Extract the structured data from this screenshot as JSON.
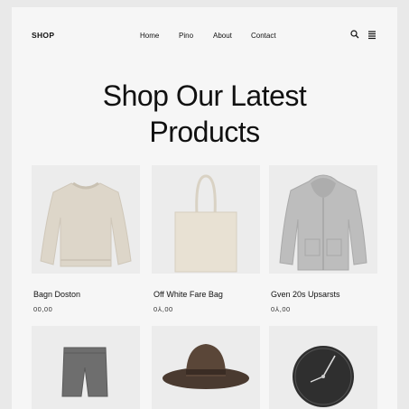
{
  "nav": {
    "logo": "SHOP",
    "links": [
      "Home",
      "Pino",
      "About",
      "Contact"
    ],
    "icons": [
      "search-icon",
      "menu-icon"
    ]
  },
  "hero": {
    "line1": "Shop Our Latest",
    "line2": "Products"
  },
  "products": [
    {
      "name": "Bagn Doston",
      "price": "00,00",
      "image": "sweater"
    },
    {
      "name": "Off White Fare Bag",
      "price": "0⅄,00",
      "image": "tote-bag"
    },
    {
      "name": "Gven 20s Upsarsts",
      "price": "0⅄,00",
      "image": "hoodie"
    },
    {
      "image": "shorts"
    },
    {
      "image": "hat"
    },
    {
      "image": "clock"
    }
  ],
  "colors": {
    "page_bg": "#f6f6f6",
    "card_bg": "#ececec",
    "text": "#111111"
  }
}
